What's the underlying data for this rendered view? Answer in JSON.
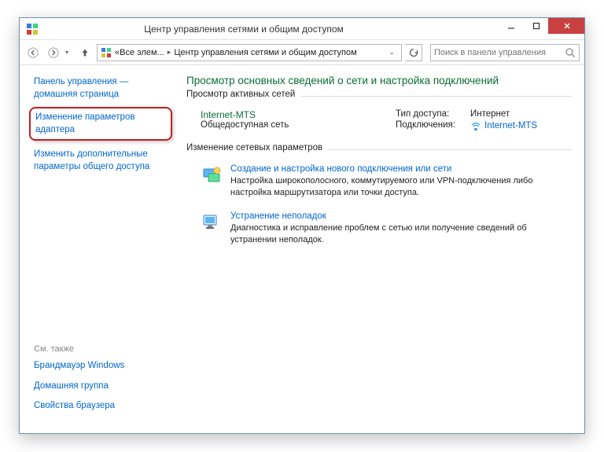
{
  "titlebar": {
    "title": "Центр управления сетями и общим доступом"
  },
  "breadcrumb": {
    "part1": "Все элем...",
    "part2": "Центр управления сетями и общим доступом"
  },
  "search": {
    "placeholder": "Поиск в панели управления"
  },
  "sidebar": {
    "home": "Панель управления — домашняя страница",
    "adapter": "Изменение параметров адаптера",
    "sharing": "Изменить дополнительные параметры общего доступа",
    "see_also_label": "См. также",
    "firewall": "Брандмауэр Windows",
    "homegroup": "Домашняя группа",
    "browser": "Свойства браузера"
  },
  "main": {
    "heading": "Просмотр основных сведений о сети и настройка подключений",
    "active_networks_legend": "Просмотр активных сетей",
    "network": {
      "name": "Internet-MTS",
      "type": "Общедоступная сеть",
      "access_label": "Тип доступа:",
      "access_value": "Интернет",
      "conn_label": "Подключения:",
      "conn_value": "Internet-MTS"
    },
    "change_settings_legend": "Изменение сетевых параметров",
    "task1": {
      "link": "Создание и настройка нового подключения или сети",
      "desc": "Настройка широкополосного, коммутируемого или VPN-подключения либо настройка маршрутизатора или точки доступа."
    },
    "task2": {
      "link": "Устранение неполадок",
      "desc": "Диагностика и исправление проблем с сетью или получение сведений об устранении неполадок."
    }
  }
}
